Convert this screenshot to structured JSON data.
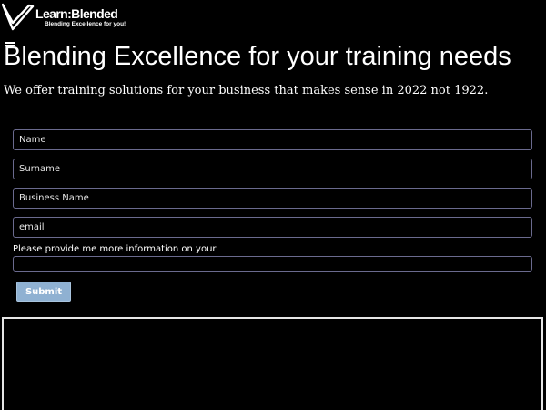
{
  "brand": {
    "name": "Learn:Blended",
    "tagline": "Blending Excellence for you!"
  },
  "header": {
    "menu_icon": "hamburger-menu-icon"
  },
  "hero": {
    "headline": "Blending Excellence for your training needs",
    "subline": "We offer training solutions for your business that makes sense in 2022 not 1922."
  },
  "form": {
    "name_placeholder": "Name",
    "surname_placeholder": "Surname",
    "business_placeholder": "Business Name",
    "email_placeholder": "email",
    "info_label": "Please provide me more information on your",
    "info_value": "",
    "submit_label": "Submit"
  },
  "colors": {
    "background": "#000000",
    "field_border": "#6a6a8e",
    "submit_bg": "#8fb1d2",
    "frame_border": "#e6e6e6"
  }
}
